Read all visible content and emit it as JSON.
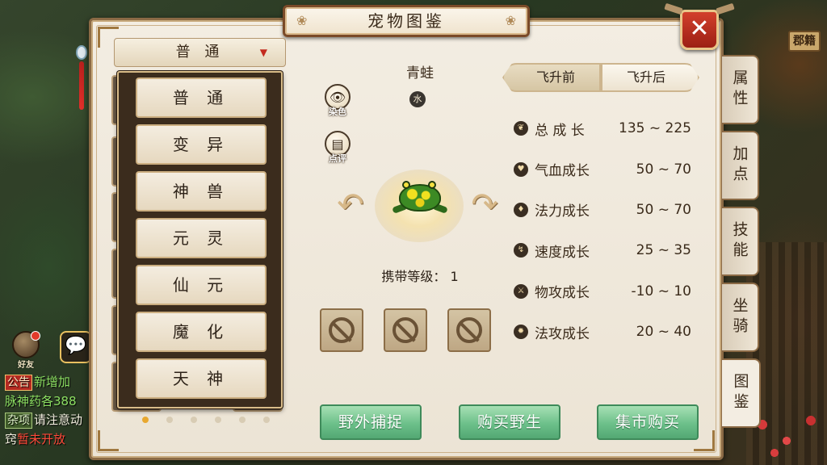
{
  "window": {
    "title": "宠物图鉴",
    "close_label": "✕"
  },
  "background": {
    "sign_text": "郡籍"
  },
  "chat": {
    "friend_label": "好友",
    "lines": [
      {
        "tag": "公告",
        "text": "新增加"
      },
      {
        "text": "脉神药各388"
      },
      {
        "tag": "杂项",
        "text": "请注意动"
      },
      {
        "prefix": "窍",
        "text": "暂未开放"
      }
    ]
  },
  "category": {
    "selected": "普 通",
    "options": [
      "普 通",
      "变 异",
      "神 兽",
      "元 灵",
      "仙 元",
      "魔 化",
      "天 神"
    ]
  },
  "pager": {
    "count": 6,
    "active": 0
  },
  "pet": {
    "name": "青蛙",
    "element": "水",
    "dye_label": "染色",
    "review_label": "点评",
    "carry_level_label": "携带等级：",
    "carry_level_value": "1",
    "skill_slots": 3
  },
  "growth": {
    "tabs": [
      {
        "label": "飞升前",
        "active": true
      },
      {
        "label": "飞升后",
        "active": false
      }
    ],
    "stats": [
      {
        "icon": "total-growth-icon",
        "glyph": "❦",
        "name": "总 成 长",
        "value": "135 ~ 225"
      },
      {
        "icon": "hp-growth-icon",
        "glyph": "♥",
        "name": "气血成长",
        "value": "50 ~ 70"
      },
      {
        "icon": "mana-growth-icon",
        "glyph": "♦",
        "name": "法力成长",
        "value": "50 ~ 70"
      },
      {
        "icon": "speed-growth-icon",
        "glyph": "↯",
        "name": "速度成长",
        "value": "25 ~ 35"
      },
      {
        "icon": "attack-growth-icon",
        "glyph": "⚔",
        "name": "物攻成长",
        "value": "-10 ~ 10"
      },
      {
        "icon": "magic-attack-growth-icon",
        "glyph": "✹",
        "name": "法攻成长",
        "value": "20 ~ 40"
      }
    ]
  },
  "actions": {
    "capture": "野外捕捉",
    "buy_wild": "购买野生",
    "market_buy": "集市购买"
  },
  "side_tabs": [
    {
      "label": "属性",
      "active": false
    },
    {
      "label": "加点",
      "active": false
    },
    {
      "label": "技能",
      "active": false
    },
    {
      "label": "坐骑",
      "active": false
    },
    {
      "label": "图鉴",
      "active": true
    }
  ],
  "colors": {
    "panel_bg": "#f3ede2",
    "frame": "#8b6a45",
    "close_red": "#c0301f",
    "action_green": "#6cc08a",
    "active_dot": "#e8a830"
  }
}
